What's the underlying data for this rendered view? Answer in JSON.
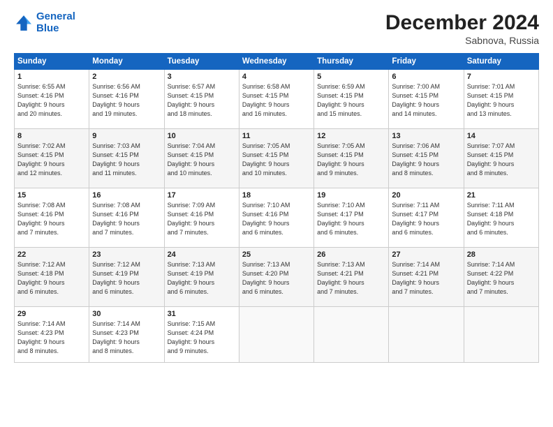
{
  "logo": {
    "line1": "General",
    "line2": "Blue"
  },
  "title": "December 2024",
  "location": "Sabnova, Russia",
  "days_of_week": [
    "Sunday",
    "Monday",
    "Tuesday",
    "Wednesday",
    "Thursday",
    "Friday",
    "Saturday"
  ],
  "weeks": [
    [
      {
        "day": "1",
        "info": "Sunrise: 6:55 AM\nSunset: 4:16 PM\nDaylight: 9 hours\nand 20 minutes."
      },
      {
        "day": "2",
        "info": "Sunrise: 6:56 AM\nSunset: 4:16 PM\nDaylight: 9 hours\nand 19 minutes."
      },
      {
        "day": "3",
        "info": "Sunrise: 6:57 AM\nSunset: 4:15 PM\nDaylight: 9 hours\nand 18 minutes."
      },
      {
        "day": "4",
        "info": "Sunrise: 6:58 AM\nSunset: 4:15 PM\nDaylight: 9 hours\nand 16 minutes."
      },
      {
        "day": "5",
        "info": "Sunrise: 6:59 AM\nSunset: 4:15 PM\nDaylight: 9 hours\nand 15 minutes."
      },
      {
        "day": "6",
        "info": "Sunrise: 7:00 AM\nSunset: 4:15 PM\nDaylight: 9 hours\nand 14 minutes."
      },
      {
        "day": "7",
        "info": "Sunrise: 7:01 AM\nSunset: 4:15 PM\nDaylight: 9 hours\nand 13 minutes."
      }
    ],
    [
      {
        "day": "8",
        "info": "Sunrise: 7:02 AM\nSunset: 4:15 PM\nDaylight: 9 hours\nand 12 minutes."
      },
      {
        "day": "9",
        "info": "Sunrise: 7:03 AM\nSunset: 4:15 PM\nDaylight: 9 hours\nand 11 minutes."
      },
      {
        "day": "10",
        "info": "Sunrise: 7:04 AM\nSunset: 4:15 PM\nDaylight: 9 hours\nand 10 minutes."
      },
      {
        "day": "11",
        "info": "Sunrise: 7:05 AM\nSunset: 4:15 PM\nDaylight: 9 hours\nand 10 minutes."
      },
      {
        "day": "12",
        "info": "Sunrise: 7:05 AM\nSunset: 4:15 PM\nDaylight: 9 hours\nand 9 minutes."
      },
      {
        "day": "13",
        "info": "Sunrise: 7:06 AM\nSunset: 4:15 PM\nDaylight: 9 hours\nand 8 minutes."
      },
      {
        "day": "14",
        "info": "Sunrise: 7:07 AM\nSunset: 4:15 PM\nDaylight: 9 hours\nand 8 minutes."
      }
    ],
    [
      {
        "day": "15",
        "info": "Sunrise: 7:08 AM\nSunset: 4:16 PM\nDaylight: 9 hours\nand 7 minutes."
      },
      {
        "day": "16",
        "info": "Sunrise: 7:08 AM\nSunset: 4:16 PM\nDaylight: 9 hours\nand 7 minutes."
      },
      {
        "day": "17",
        "info": "Sunrise: 7:09 AM\nSunset: 4:16 PM\nDaylight: 9 hours\nand 7 minutes."
      },
      {
        "day": "18",
        "info": "Sunrise: 7:10 AM\nSunset: 4:16 PM\nDaylight: 9 hours\nand 6 minutes."
      },
      {
        "day": "19",
        "info": "Sunrise: 7:10 AM\nSunset: 4:17 PM\nDaylight: 9 hours\nand 6 minutes."
      },
      {
        "day": "20",
        "info": "Sunrise: 7:11 AM\nSunset: 4:17 PM\nDaylight: 9 hours\nand 6 minutes."
      },
      {
        "day": "21",
        "info": "Sunrise: 7:11 AM\nSunset: 4:18 PM\nDaylight: 9 hours\nand 6 minutes."
      }
    ],
    [
      {
        "day": "22",
        "info": "Sunrise: 7:12 AM\nSunset: 4:18 PM\nDaylight: 9 hours\nand 6 minutes."
      },
      {
        "day": "23",
        "info": "Sunrise: 7:12 AM\nSunset: 4:19 PM\nDaylight: 9 hours\nand 6 minutes."
      },
      {
        "day": "24",
        "info": "Sunrise: 7:13 AM\nSunset: 4:19 PM\nDaylight: 9 hours\nand 6 minutes."
      },
      {
        "day": "25",
        "info": "Sunrise: 7:13 AM\nSunset: 4:20 PM\nDaylight: 9 hours\nand 6 minutes."
      },
      {
        "day": "26",
        "info": "Sunrise: 7:13 AM\nSunset: 4:21 PM\nDaylight: 9 hours\nand 7 minutes."
      },
      {
        "day": "27",
        "info": "Sunrise: 7:14 AM\nSunset: 4:21 PM\nDaylight: 9 hours\nand 7 minutes."
      },
      {
        "day": "28",
        "info": "Sunrise: 7:14 AM\nSunset: 4:22 PM\nDaylight: 9 hours\nand 7 minutes."
      }
    ],
    [
      {
        "day": "29",
        "info": "Sunrise: 7:14 AM\nSunset: 4:23 PM\nDaylight: 9 hours\nand 8 minutes."
      },
      {
        "day": "30",
        "info": "Sunrise: 7:14 AM\nSunset: 4:23 PM\nDaylight: 9 hours\nand 8 minutes."
      },
      {
        "day": "31",
        "info": "Sunrise: 7:15 AM\nSunset: 4:24 PM\nDaylight: 9 hours\nand 9 minutes."
      },
      {
        "day": "",
        "info": ""
      },
      {
        "day": "",
        "info": ""
      },
      {
        "day": "",
        "info": ""
      },
      {
        "day": "",
        "info": ""
      }
    ]
  ]
}
